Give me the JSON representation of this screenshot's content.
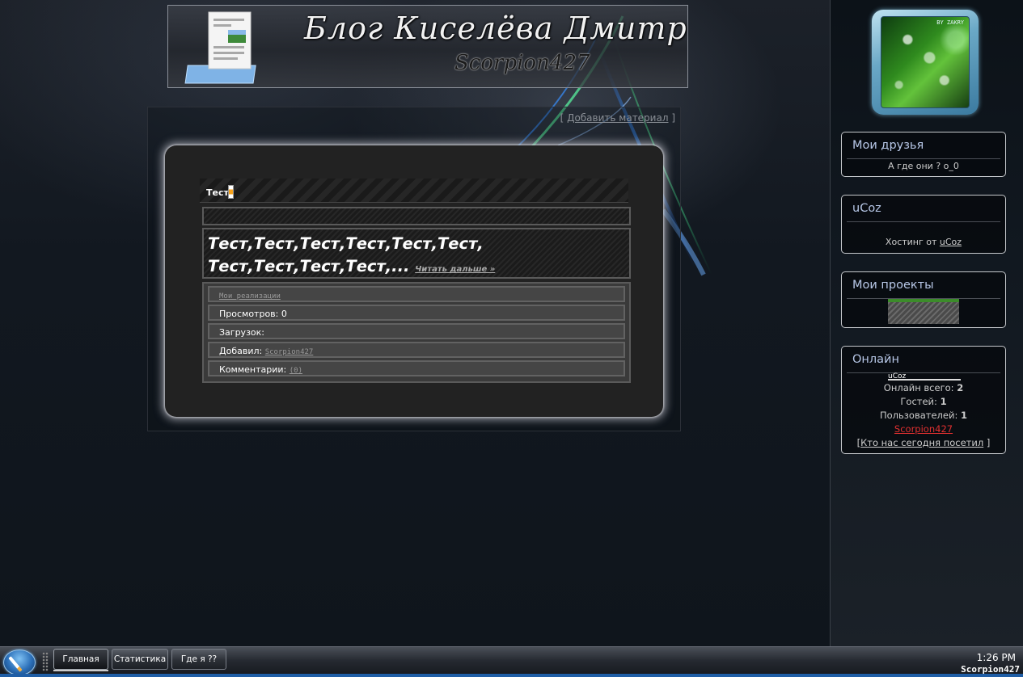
{
  "header": {
    "title": "Блог Киселёва Дмитрия",
    "subtitle": "Scorpion427"
  },
  "content": {
    "add_material_open": "[ ",
    "add_material_label": "Добавить материал",
    "add_material_close": " ]",
    "entry": {
      "title": "Тест",
      "text": "Тест,Тест,Тест,Тест,Тест,Тест, Тест,Тест,Тест,Тест,...",
      "read_more": "Читать дальше »",
      "category": "Мои реализации",
      "views_label": "Просмотров: ",
      "views": "0",
      "downloads_label": "Загрузок:",
      "added_by_label": "Добавил: ",
      "added_by": "Scorpion427",
      "comments_label": "Комментарии: ",
      "comments": "(0)"
    }
  },
  "sidebar": {
    "avatar_tag": "BY ZAKRY",
    "friends": {
      "title": "Мои друзья",
      "text": "А где они ? o_0"
    },
    "ucoz": {
      "title": "uCoz",
      "text_prefix": "Хостинг от ",
      "link": "uCoz"
    },
    "projects": {
      "title": "Мои проекты"
    },
    "online": {
      "title": "Онлайн",
      "counter": "uCoz",
      "total_label": "Онлайн всего: ",
      "total": "2",
      "guests_label": "Гостей: ",
      "guests": "1",
      "users_label": "Пользователей: ",
      "users": "1",
      "user_name": "Scorpion427",
      "visitors_open": "[",
      "visitors_link": "Кто нас сегодня посетил",
      "visitors_close": " ]"
    }
  },
  "taskbar": {
    "start_icon": "start-orb-icon",
    "buttons": [
      "Главная",
      "Статистика",
      "Где я ??"
    ],
    "clock": "1:26 PM",
    "user": "Scorpion427"
  },
  "colors": {
    "accent_blue": "#b8c8e8",
    "online_user": "#e03030",
    "taskbar_strip": "#1f5ea6"
  }
}
